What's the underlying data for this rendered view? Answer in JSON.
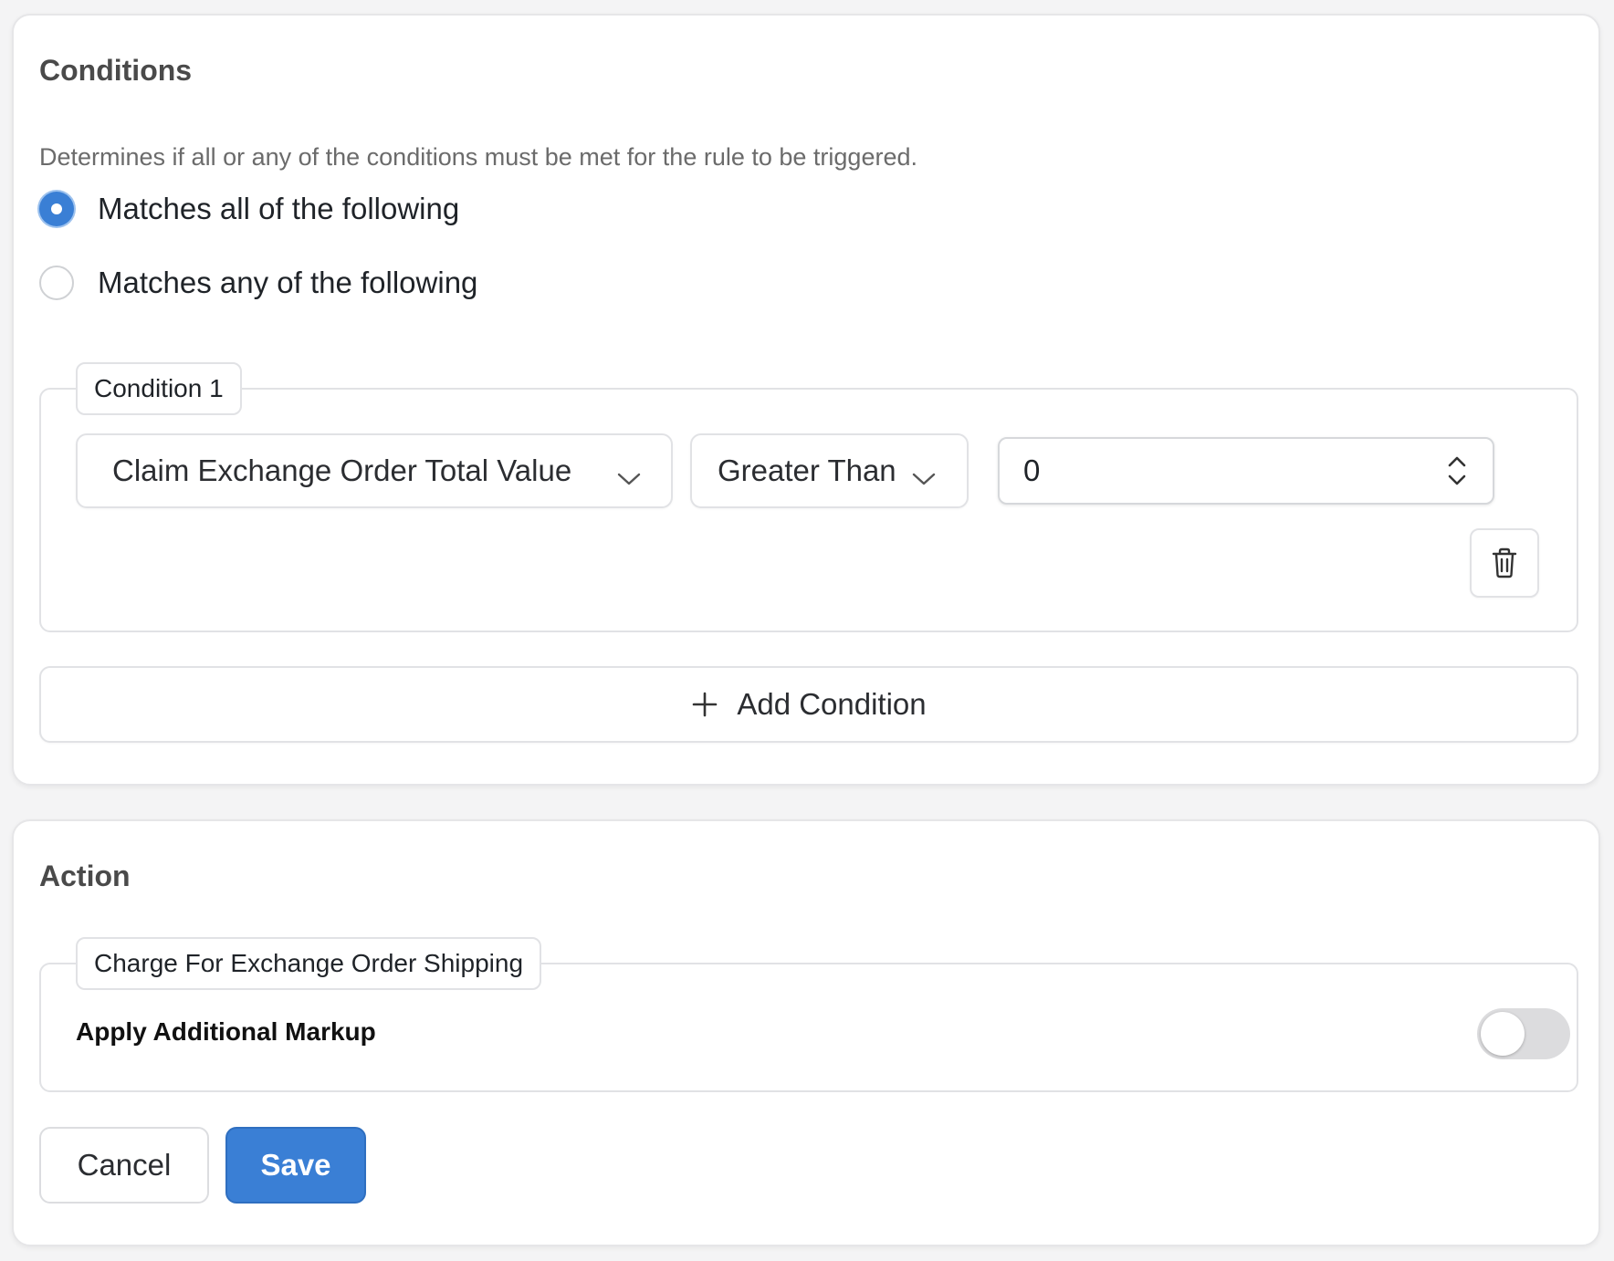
{
  "conditions_card": {
    "title": "Conditions",
    "description": "Determines if all or any of the conditions must be met for the rule to be triggered.",
    "match_options": [
      {
        "label": "Matches all of the following",
        "selected": true
      },
      {
        "label": "Matches any of the following",
        "selected": false
      }
    ],
    "condition_1": {
      "legend": "Condition 1",
      "field_select": "Claim Exchange Order Total Value",
      "operator_select": "Greater Than",
      "value": "0"
    },
    "add_condition_label": "Add Condition"
  },
  "action_card": {
    "title": "Action",
    "legend": "Charge For Exchange Order Shipping",
    "markup_label": "Apply Additional Markup",
    "markup_enabled": false
  },
  "buttons": {
    "cancel": "Cancel",
    "save": "Save"
  },
  "colors": {
    "accent": "#3a7fd5",
    "border": "#e1e2e5",
    "toggle_off": "#dcdcde"
  },
  "icons": {
    "field_chevron": "chevron-down-icon",
    "operator_chevron": "chevron-down-icon",
    "stepper": "up-down-stepper-icon",
    "delete": "trash-icon",
    "add": "plus-icon"
  }
}
